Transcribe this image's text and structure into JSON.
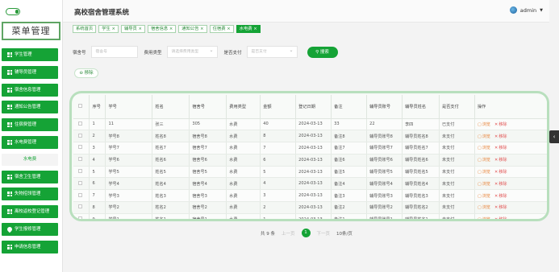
{
  "app": {
    "title": "高校宿舍管理系统"
  },
  "user": {
    "name": "admin"
  },
  "sidebar": {
    "title": "菜单管理",
    "items": [
      {
        "label": "学生管理"
      },
      {
        "label": "辅导员管理"
      },
      {
        "label": "宿舍信息管理"
      },
      {
        "label": "通知公告管理"
      },
      {
        "label": "住宿费管理"
      },
      {
        "label": "水电费管理"
      },
      {
        "label": "水电费",
        "sub": true
      },
      {
        "label": "宿舍卫生管理"
      },
      {
        "label": "失物招领管理"
      },
      {
        "label": "离校返校登记管理"
      },
      {
        "label": "学生报修管理"
      },
      {
        "label": "申请信息管理"
      }
    ]
  },
  "tags": [
    {
      "label": "系统首页",
      "closable": false,
      "active": false
    },
    {
      "label": "学生",
      "closable": true,
      "active": false
    },
    {
      "label": "辅导员",
      "closable": true,
      "active": false
    },
    {
      "label": "宿舍信息",
      "closable": true,
      "active": false
    },
    {
      "label": "通知公告",
      "closable": true,
      "active": false
    },
    {
      "label": "住宿费",
      "closable": true,
      "active": false
    },
    {
      "label": "水电费",
      "closable": true,
      "active": true
    }
  ],
  "search": {
    "dorm_label": "宿舍号",
    "dorm_placeholder": "宿舍号",
    "fee_label": "费用类型",
    "fee_placeholder": "请选择费用类型",
    "paid_label": "是否支付",
    "paid_placeholder": "是否支付",
    "button": "搜索"
  },
  "actions": {
    "remove": "移除"
  },
  "table": {
    "headers": [
      "",
      "序号",
      "学号",
      "姓名",
      "宿舍号",
      "费用类型",
      "金额",
      "登记日期",
      "备注",
      "辅导员账号",
      "辅导员姓名",
      "是否支付",
      "操作"
    ],
    "view_label": "浏览",
    "delete_label": "移除",
    "rows": [
      [
        "1",
        "11",
        "张三",
        "305",
        "水费",
        "40",
        "2024-03-13",
        "33",
        "22",
        "李四",
        "已支付"
      ],
      [
        "2",
        "学号8",
        "姓名8",
        "宿舍号8",
        "水费",
        "8",
        "2024-03-13",
        "备注8",
        "辅导员账号8",
        "辅导员姓名8",
        "未支付"
      ],
      [
        "3",
        "学号7",
        "姓名7",
        "宿舍号7",
        "水费",
        "7",
        "2024-03-13",
        "备注7",
        "辅导员账号7",
        "辅导员姓名7",
        "未支付"
      ],
      [
        "4",
        "学号6",
        "姓名6",
        "宿舍号6",
        "水费",
        "6",
        "2024-03-13",
        "备注6",
        "辅导员账号6",
        "辅导员姓名6",
        "未支付"
      ],
      [
        "5",
        "学号5",
        "姓名5",
        "宿舍号5",
        "水费",
        "5",
        "2024-03-13",
        "备注5",
        "辅导员账号5",
        "辅导员姓名5",
        "未支付"
      ],
      [
        "6",
        "学号4",
        "姓名4",
        "宿舍号4",
        "水费",
        "4",
        "2024-03-13",
        "备注4",
        "辅导员账号4",
        "辅导员姓名4",
        "未支付"
      ],
      [
        "7",
        "学号3",
        "姓名3",
        "宿舍号3",
        "水费",
        "3",
        "2024-03-13",
        "备注3",
        "辅导员账号3",
        "辅导员姓名3",
        "未支付"
      ],
      [
        "8",
        "学号2",
        "姓名2",
        "宿舍号2",
        "水费",
        "2",
        "2024-03-13",
        "备注2",
        "辅导员账号2",
        "辅导员姓名2",
        "未支付"
      ],
      [
        "9",
        "学号1",
        "姓名1",
        "宿舍号1",
        "水费",
        "1",
        "2024-03-13",
        "备注1",
        "辅导员账号1",
        "辅导员姓名1",
        "未支付"
      ]
    ]
  },
  "pagination": {
    "total": "共 9 条",
    "prev": "上一页",
    "current": "1",
    "next": "下一页",
    "page_size": "10条/页"
  },
  "colors": {
    "primary": "#15a336",
    "accent_border": "#b8dfbd",
    "view": "#e8843a",
    "delete": "#e25555"
  }
}
